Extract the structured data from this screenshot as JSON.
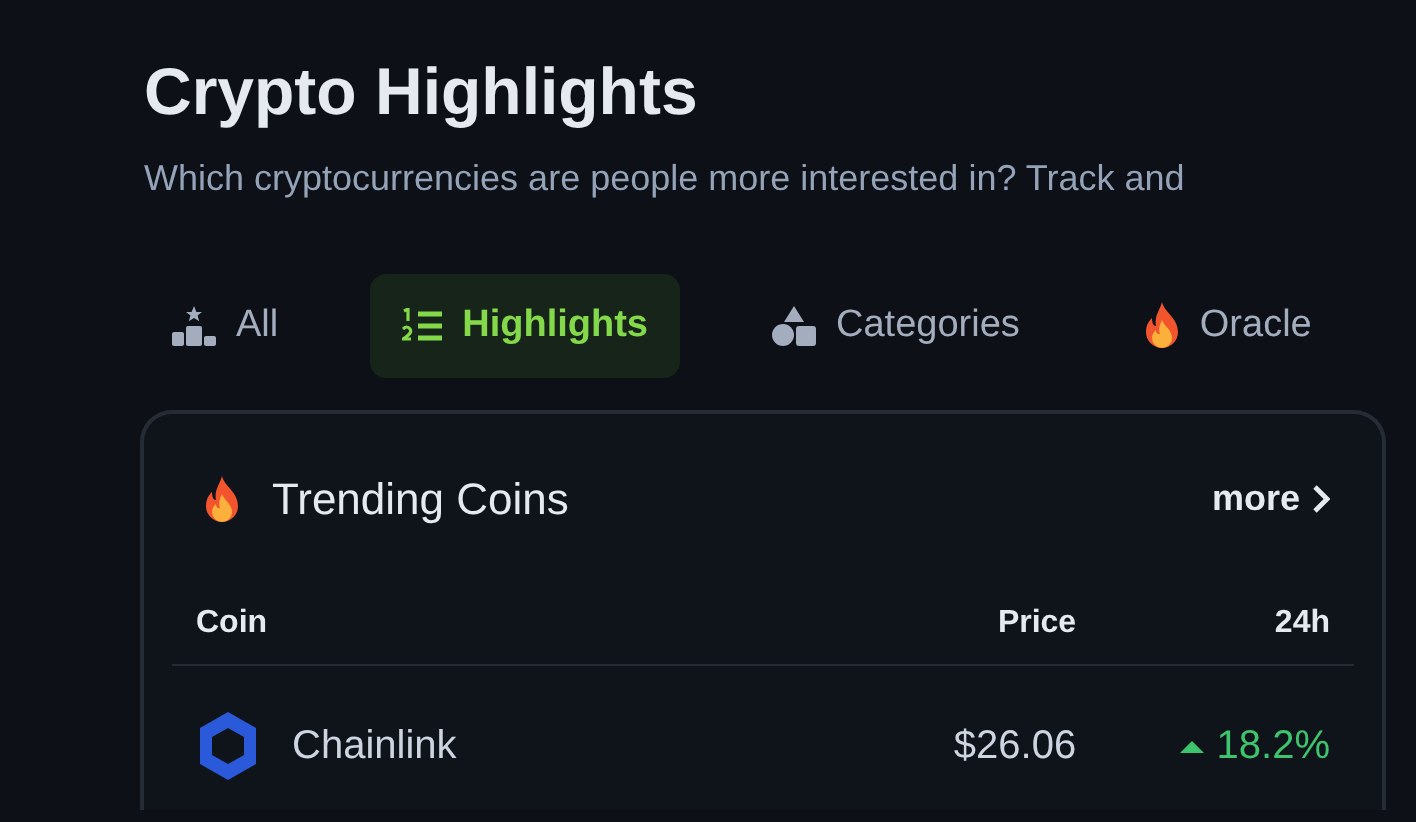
{
  "header": {
    "title": "Crypto Highlights",
    "subtitle": "Which cryptocurrencies are people more interested in? Track and"
  },
  "tabs": [
    {
      "label": "All",
      "selected": false
    },
    {
      "label": "Highlights",
      "selected": true
    },
    {
      "label": "Categories",
      "selected": false
    },
    {
      "label": "Oracle",
      "selected": false
    }
  ],
  "card": {
    "title": "Trending Coins",
    "more_link": "more",
    "table": {
      "columns": [
        "Coin",
        "Price",
        "24h"
      ],
      "rows": [
        {
          "coin": "Chainlink",
          "price": "$26.06",
          "change": "18.2%"
        }
      ]
    }
  }
}
